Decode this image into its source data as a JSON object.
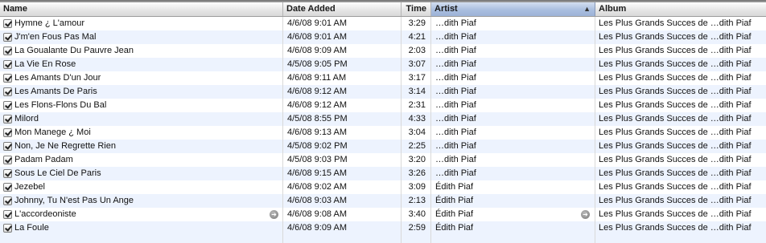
{
  "headers": {
    "name": "Name",
    "date_added": "Date Added",
    "time": "Time",
    "artist": "Artist",
    "album": "Album",
    "sort_indicator": "▲"
  },
  "go_icon_glyph": "➜",
  "rows": [
    {
      "name": "Hymne ¿ L'amour",
      "date": "4/6/08 9:01 AM",
      "time": "3:29",
      "artist": "…dith Piaf",
      "album": "Les Plus Grands Succes de …dith Piaf"
    },
    {
      "name": "J'm'en Fous Pas Mal",
      "date": "4/6/08 9:01 AM",
      "time": "4:21",
      "artist": "…dith Piaf",
      "album": "Les Plus Grands Succes de …dith Piaf"
    },
    {
      "name": "La Goualante Du Pauvre Jean",
      "date": "4/6/08 9:09 AM",
      "time": "2:03",
      "artist": "…dith Piaf",
      "album": "Les Plus Grands Succes de …dith Piaf"
    },
    {
      "name": "La Vie En Rose",
      "date": "4/5/08 9:05 PM",
      "time": "3:07",
      "artist": "…dith Piaf",
      "album": "Les Plus Grands Succes de …dith Piaf"
    },
    {
      "name": "Les Amants D'un Jour",
      "date": "4/6/08 9:11 AM",
      "time": "3:17",
      "artist": "…dith Piaf",
      "album": "Les Plus Grands Succes de …dith Piaf"
    },
    {
      "name": "Les Amants De Paris",
      "date": "4/6/08 9:12 AM",
      "time": "3:14",
      "artist": "…dith Piaf",
      "album": "Les Plus Grands Succes de …dith Piaf"
    },
    {
      "name": "Les Flons-Flons Du Bal",
      "date": "4/6/08 9:12 AM",
      "time": "2:31",
      "artist": "…dith Piaf",
      "album": "Les Plus Grands Succes de …dith Piaf"
    },
    {
      "name": "Milord",
      "date": "4/5/08 8:55 PM",
      "time": "4:33",
      "artist": "…dith Piaf",
      "album": "Les Plus Grands Succes de …dith Piaf"
    },
    {
      "name": "Mon Manege ¿ Moi",
      "date": "4/6/08 9:13 AM",
      "time": "3:04",
      "artist": "…dith Piaf",
      "album": "Les Plus Grands Succes de …dith Piaf"
    },
    {
      "name": "Non, Je Ne Regrette Rien",
      "date": "4/5/08 9:02 PM",
      "time": "2:25",
      "artist": "…dith Piaf",
      "album": "Les Plus Grands Succes de …dith Piaf"
    },
    {
      "name": "Padam Padam",
      "date": "4/5/08 9:03 PM",
      "time": "3:20",
      "artist": "…dith Piaf",
      "album": "Les Plus Grands Succes de …dith Piaf"
    },
    {
      "name": "Sous Le Ciel De Paris",
      "date": "4/6/08 9:15 AM",
      "time": "3:26",
      "artist": "…dith Piaf",
      "album": "Les Plus Grands Succes de …dith Piaf"
    },
    {
      "name": "Jezebel",
      "date": "4/6/08 9:02 AM",
      "time": "3:09",
      "artist": "Édith Piaf",
      "album": "Les Plus Grands Succes de …dith Piaf"
    },
    {
      "name": "Johnny, Tu N'est Pas Un Ange",
      "date": "4/6/08 9:03 AM",
      "time": "2:13",
      "artist": "Édith Piaf",
      "album": "Les Plus Grands Succes de …dith Piaf"
    },
    {
      "name": "L'accordeoniste",
      "date": "4/6/08 9:08 AM",
      "time": "3:40",
      "artist": "Édith Piaf",
      "album": "Les Plus Grands Succes de …dith Piaf",
      "show_go": true
    },
    {
      "name": "La Foule",
      "date": "4/6/08 9:09 AM",
      "time": "2:59",
      "artist": "Édith Piaf",
      "album": "Les Plus Grands Succes de …dith Piaf"
    }
  ]
}
